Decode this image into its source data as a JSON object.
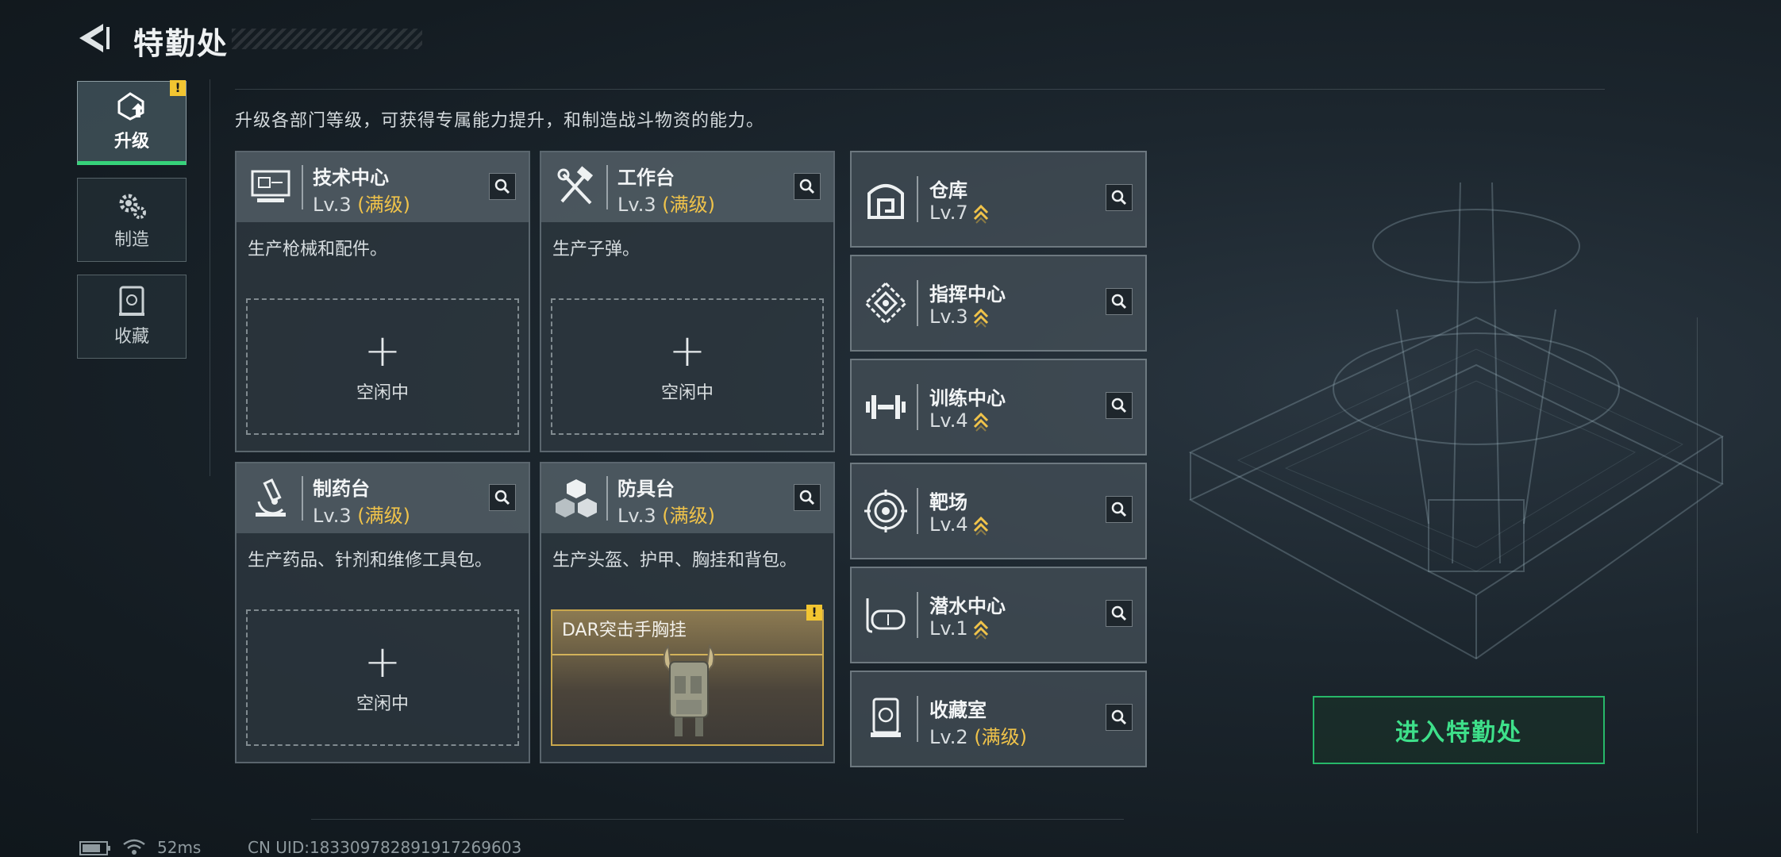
{
  "header": {
    "title": "特勤处"
  },
  "nav": [
    {
      "label": "升级",
      "icon": "upgrade-icon",
      "active": true,
      "warning": "!"
    },
    {
      "label": "制造",
      "icon": "gears-icon",
      "active": false
    },
    {
      "label": "收藏",
      "icon": "collection-icon",
      "active": false
    }
  ],
  "description": "升级各部门等级，可获得专属能力提升，和制造战斗物资的能力。",
  "stations": [
    {
      "name": "技术中心",
      "level": "Lv.3",
      "max_tag": "(满级)",
      "text": "生产枪械和配件。",
      "slot_plus": "+",
      "slot_status": "空闲中"
    },
    {
      "name": "工作台",
      "level": "Lv.3",
      "max_tag": "(满级)",
      "text": "生产子弹。",
      "slot_plus": "+",
      "slot_status": "空闲中"
    },
    {
      "name": "制药台",
      "level": "Lv.3",
      "max_tag": "(满级)",
      "text": "生产药品、针剂和维修工具包。",
      "slot_plus": "+",
      "slot_status": "空闲中"
    },
    {
      "name": "防具台",
      "level": "Lv.3",
      "max_tag": "(满级)",
      "text": "生产头盔、护甲、胸挂和背包。",
      "item_name": "DAR突击手胸挂",
      "item_warning": "!"
    }
  ],
  "departments": [
    {
      "name": "仓库",
      "level": "Lv.7",
      "icon": "warehouse-icon",
      "upgradable": true
    },
    {
      "name": "指挥中心",
      "level": "Lv.3",
      "icon": "command-center-icon",
      "upgradable": true
    },
    {
      "name": "训练中心",
      "level": "Lv.4",
      "icon": "dumbbell-icon",
      "upgradable": true
    },
    {
      "name": "靶场",
      "level": "Lv.4",
      "icon": "target-icon",
      "upgradable": true
    },
    {
      "name": "潜水中心",
      "level": "Lv.1",
      "icon": "diving-mask-icon",
      "upgradable": true
    },
    {
      "name": "收藏室",
      "level": "Lv.2",
      "max_tag": "(满级)",
      "icon": "collection-room-icon",
      "upgradable": false
    }
  ],
  "enter_button": "进入特勤处",
  "status_bar": {
    "ping": "52ms",
    "uid": "CN UID:1833097828919172696​03"
  },
  "colors": {
    "accent_green": "#36d27a",
    "max_level_gold": "#f0c34a",
    "warning_yellow": "#f2c531"
  }
}
